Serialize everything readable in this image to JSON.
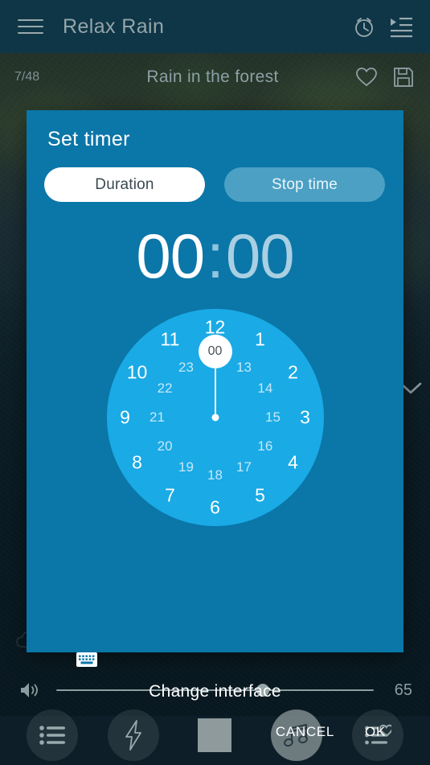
{
  "app": {
    "title": "Relax Rain",
    "menu_icon": "hamburger-menu-icon",
    "alarm_icon": "alarm-clock-icon",
    "playlist_icon": "playlist-queue-icon"
  },
  "track": {
    "counter": "7/48",
    "title": "Rain in the forest",
    "favorite_icon": "heart-outline-icon",
    "save_icon": "save-floppy-icon",
    "collapse_icon": "chevron-down-icon"
  },
  "dialog": {
    "title": "Set timer",
    "tabs": [
      {
        "label": "Duration",
        "selected": true
      },
      {
        "label": "Stop time",
        "selected": false
      }
    ],
    "time": {
      "hours": "00",
      "separator": ":",
      "minutes": "00",
      "active_field": "hours"
    },
    "clock": {
      "mode": "24-hour",
      "selected_value": "00",
      "outer_numbers": [
        "12",
        "1",
        "2",
        "3",
        "4",
        "5",
        "6",
        "7",
        "8",
        "9",
        "10",
        "11"
      ],
      "inner_numbers": [
        "00",
        "13",
        "14",
        "15",
        "16",
        "17",
        "18",
        "19",
        "20",
        "21",
        "22",
        "23"
      ]
    },
    "keyboard_icon": "keyboard-icon",
    "change_interface": "Change interface",
    "cancel_label": "CANCEL",
    "ok_label": "OK"
  },
  "player": {
    "volume_icon": "volume-speaker-icon",
    "volume_value": "65",
    "volume_percent": 65,
    "buttons": [
      {
        "icon": "bulleted-list-icon",
        "active": false
      },
      {
        "icon": "lightning-bolt-icon",
        "active": false
      },
      {
        "icon": "stop-square-icon",
        "active": false
      },
      {
        "icon": "music-note-icon",
        "active": true
      },
      {
        "icon": "favorites-list-icon",
        "active": false
      }
    ]
  },
  "colors": {
    "appbar_bg": "#0e3647",
    "dialog_bg": "#0b76a8",
    "clock_face": "#1aaae5",
    "pill_selected": "#ffffff",
    "pill_unselected": "#4ba0c4",
    "text_muted": "#8ea0a5"
  }
}
